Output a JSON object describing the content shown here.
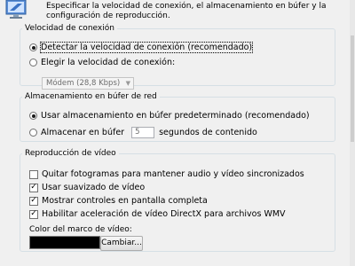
{
  "header": {
    "icon": "monitor-settings-icon",
    "text": "Especificar la velocidad de conexión, el almacenamiento en búfer y la configuración de reproducción."
  },
  "connection": {
    "legend": "Velocidad de conexión",
    "detect_label": "Detectar la velocidad de conexión (recomendado)",
    "detect_checked": true,
    "choose_label": "Elegir la velocidad de conexión:",
    "choose_checked": false,
    "speed_value": "Módem (28,8 Kbps)"
  },
  "buffering": {
    "legend": "Almacenamiento en búfer de red",
    "default_label": "Usar almacenamiento en búfer predeterminado (recomendado)",
    "default_checked": true,
    "custom_label": "Almacenar en búfer",
    "custom_checked": false,
    "seconds_value": "5",
    "seconds_suffix": "segundos de contenido"
  },
  "playback": {
    "legend": "Reproducción de vídeo",
    "options": [
      {
        "label": "Quitar fotogramas para mantener audio y vídeo sincronizados",
        "checked": false
      },
      {
        "label": "Usar suavizado de vídeo",
        "checked": true
      },
      {
        "label": "Mostrar controles en pantalla completa",
        "checked": true
      },
      {
        "label": "Habilitar aceleración de vídeo DirectX para archivos WMV",
        "checked": true
      }
    ],
    "border_color_label": "Color del marco de vídeo:",
    "border_color": "#000000",
    "change_button": "Cambiar..."
  }
}
